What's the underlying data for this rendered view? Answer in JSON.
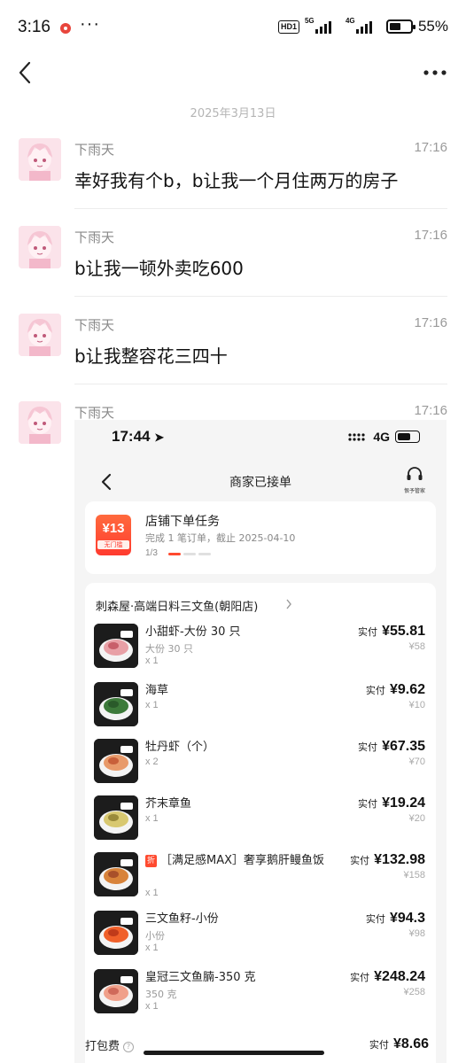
{
  "status_bar": {
    "time": "3:16",
    "more": "···",
    "hd": "HD1",
    "net1": "5G",
    "net2": "4G",
    "battery": "55%",
    "battery_level": 0.55
  },
  "nav": {
    "back_icon": "chevron-left-icon",
    "more_icon": "more-horizontal-icon"
  },
  "date_separator": "2025年3月13日",
  "messages": [
    {
      "name": "下雨天",
      "time": "17:16",
      "text": "幸好我有个b，b让我一个月住两万的房子"
    },
    {
      "name": "下雨天",
      "time": "17:16",
      "text": "b让我一顿外卖吃600"
    },
    {
      "name": "下雨天",
      "time": "17:16",
      "text": "b让我整容花三四十"
    },
    {
      "name": "下雨天",
      "time": "17:16"
    }
  ],
  "shot": {
    "status": {
      "time": "17:44",
      "signal": "4G"
    },
    "title": "商家已接单",
    "customer_service_label": "恨予管家",
    "task": {
      "badge_amount": "¥13",
      "badge_sub": "无门槛",
      "title": "店铺下单任务",
      "desc": "完成 1 笔订单，截止 2025-04-10",
      "progress": "1/3"
    },
    "store": "刺森屋·高端日料三文鱼(朝阳店)",
    "paid_label": "实付",
    "items": [
      {
        "name": "小甜虾-大份 30 只",
        "sub": "大份 30 只",
        "qty": "x 1",
        "paid": "¥55.81",
        "orig": "¥58"
      },
      {
        "name": "海草",
        "sub": "",
        "qty": "x 1",
        "paid": "¥9.62",
        "orig": "¥10"
      },
      {
        "name": "牡丹虾（个）",
        "sub": "",
        "qty": "x 2",
        "paid": "¥67.35",
        "orig": "¥70"
      },
      {
        "name": "芥末章鱼",
        "sub": "",
        "qty": "x 1",
        "paid": "¥19.24",
        "orig": "¥20"
      },
      {
        "tag": "折",
        "name": "［满足感MAX］奢享鹅肝鳗鱼饭",
        "sub": "",
        "qty": "x 1",
        "paid": "¥132.98",
        "orig": "¥158"
      },
      {
        "name": "三文鱼籽-小份",
        "sub": "小份",
        "qty": "x 1",
        "paid": "¥94.3",
        "orig": "¥98"
      },
      {
        "name": "皇冠三文鱼腩-350 克",
        "sub": "350 克",
        "qty": "x 1",
        "paid": "¥248.24",
        "orig": "¥258"
      }
    ],
    "packing": {
      "label": "打包费",
      "paid": "¥8.66"
    }
  },
  "colors": {
    "accent": "#ff4a2f",
    "muted": "#9a9a9a",
    "separator": "#ececec"
  }
}
